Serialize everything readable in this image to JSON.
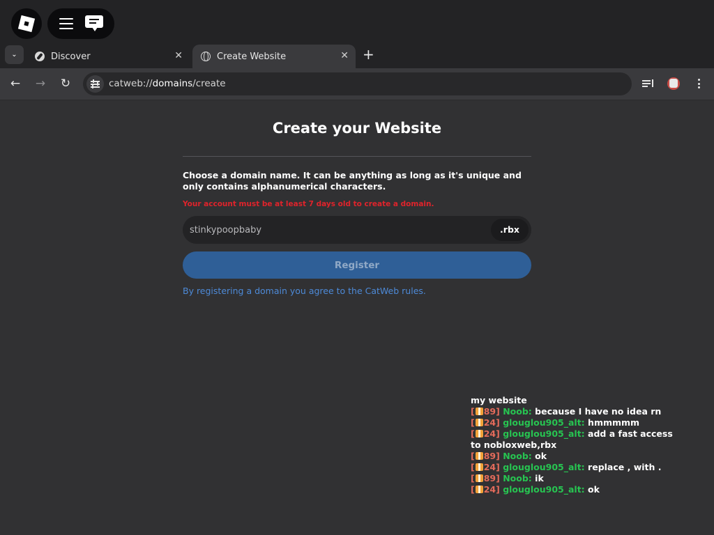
{
  "browser": {
    "tabs": [
      {
        "label": "Discover",
        "icon": "compass-icon",
        "active": false
      },
      {
        "label": "Create Website",
        "icon": "globe-icon",
        "active": true
      }
    ],
    "close_glyph": "✕",
    "new_tab_glyph": "+",
    "tab_list_glyph": "⌄",
    "url_scheme": "catweb://",
    "url_host": "domains",
    "url_path": "/create",
    "nav": {
      "back": "←",
      "forward": "→",
      "reload": "↻"
    }
  },
  "page": {
    "title": "Create your Website",
    "description": "Choose a domain name. It can be anything as long as it's unique and only contains alphanumerical characters.",
    "warning": "Your account must be at least 7 days old to create a domain.",
    "domain_placeholder": "stinkypoopbaby",
    "tld": ".rbx",
    "register_label": "Register",
    "rules_text": "By registering a domain you agree to the CatWeb rules."
  },
  "colors": {
    "background": "#313133",
    "warning": "#e0232b",
    "register_button": "#2f5f97",
    "link": "#4d8ad8",
    "username": "#27c451",
    "level_badge": "#e46b5b"
  },
  "chat": {
    "lines": [
      {
        "level": "",
        "user": "",
        "message": "my website"
      },
      {
        "level": "89",
        "user": "Noob:",
        "message": "because I have no idea rn"
      },
      {
        "level": "24",
        "user": "glouglou905_alt:",
        "message": "hmmmmm"
      },
      {
        "level": "24",
        "user": "glouglou905_alt:",
        "message": "add a fast access to nobloxweb,rbx"
      },
      {
        "level": "89",
        "user": "Noob:",
        "message": "ok"
      },
      {
        "level": "24",
        "user": "glouglou905_alt:",
        "message": "replace , with ."
      },
      {
        "level": "89",
        "user": "Noob:",
        "message": "ik"
      },
      {
        "level": "24",
        "user": "glouglou905_alt:",
        "message": "ok"
      }
    ]
  }
}
